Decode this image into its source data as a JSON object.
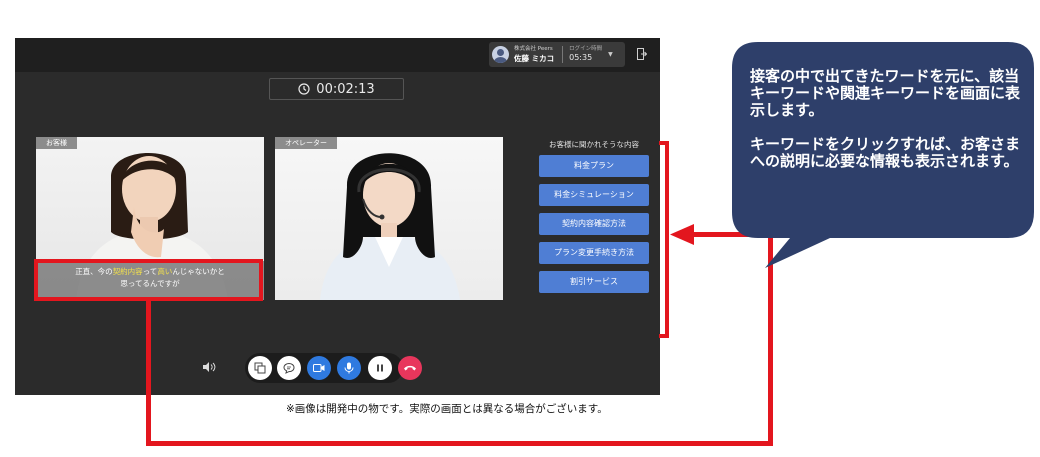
{
  "header": {
    "company": "株式会社 Peers",
    "user_name": "佐藤 ミカコ",
    "login_label": "ログイン時間",
    "login_time": "05:35"
  },
  "timer": "00:02:13",
  "customer_panel": {
    "label": "お客様"
  },
  "operator_panel": {
    "label": "オペレーター"
  },
  "caption": {
    "part1": "正直、今の",
    "keyword1": "契約内容",
    "part2": "って",
    "keyword2": "高い",
    "part3": "んじゃないかと",
    "line2": "思ってるんですが"
  },
  "suggestions": {
    "title": "お客様に聞かれそうな内容",
    "items": [
      "料金プラン",
      "料金シミュレーション",
      "契約内容確認方法",
      "プラン変更手続き方法",
      "割引サービス"
    ]
  },
  "controls": [
    "screen-share",
    "chat",
    "video",
    "microphone",
    "pause",
    "hang-up"
  ],
  "colors": {
    "keyword_button": "#4f7ed4",
    "highlight": "#f2e04c",
    "annotation_red": "#e3161e",
    "bubble": "#2e3f6a",
    "end_call": "#e8365c",
    "active_blue": "#2f7ae0"
  },
  "note": "※画像は開発中の物です。実際の画面とは異なる場合がございます。",
  "callout": {
    "paragraph1": "接客の中で出てきたワードを元に、該当キーワードや関連キーワードを画面に表示します。",
    "paragraph2": "キーワードをクリックすれば、お客さまへの説明に必要な情報も表示されます。"
  }
}
